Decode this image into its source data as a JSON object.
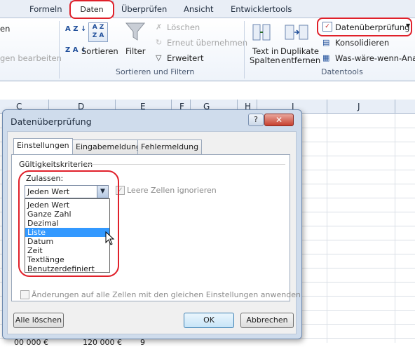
{
  "ribbon": {
    "tabs": [
      "Formeln",
      "Daten",
      "Überprüfen",
      "Ansicht",
      "Entwicklertools"
    ],
    "active_tab": "Daten",
    "left_items": [
      "en",
      "gen bearbeiten"
    ],
    "sort": {
      "az_label": "A Z",
      "za_label": "Z A",
      "sort_label": "Sortieren"
    },
    "filter": {
      "label": "Filter",
      "loeschen": "Löschen",
      "erneut": "Erneut übernehmen",
      "erweitert": "Erweitert"
    },
    "group_sort_filter": "Sortieren und Filtern",
    "tools": {
      "text_in_spalten_1": "Text in",
      "text_in_spalten_2": "Spalten",
      "duplikate_1": "Duplikate",
      "duplikate_2": "entfernen",
      "datenueberpruefung": "Datenüberprüfung",
      "konsolidieren": "Konsolidieren",
      "was_waere_wenn": "Was-wäre-wenn-Analy"
    },
    "group_datentools": "Datentools"
  },
  "sheet": {
    "columns": [
      "C",
      "D",
      "E",
      "F",
      "G",
      "H",
      "I",
      "J"
    ],
    "bottom_row": [
      "00 000 €",
      "120 000 €",
      "9"
    ]
  },
  "dialog": {
    "title": "Datenüberprüfung",
    "help": "?",
    "close": "✕",
    "tabs": [
      "Einstellungen",
      "Eingabemeldung",
      "Fehlermeldung"
    ],
    "section": "Gültigkeitskriterien",
    "zulassen_label": "Zulassen:",
    "combo_value": "Jeden Wert",
    "dropdown_items": [
      "Jeden Wert",
      "Ganze Zahl",
      "Dezimal",
      "Liste",
      "Datum",
      "Zeit",
      "Textlänge",
      "Benutzerdefiniert"
    ],
    "selected_index": 3,
    "leere_zellen": "Leere Zellen ignorieren",
    "aenderungen": "Änderungen auf alle Zellen mit den gleichen Einstellungen anwenden",
    "buttons": {
      "alle_loeschen": "Alle löschen",
      "ok": "OK",
      "abbrechen": "Abbrechen"
    }
  },
  "colors": {
    "annotation_red": "#e0202a",
    "selection_blue": "#3399ff"
  }
}
